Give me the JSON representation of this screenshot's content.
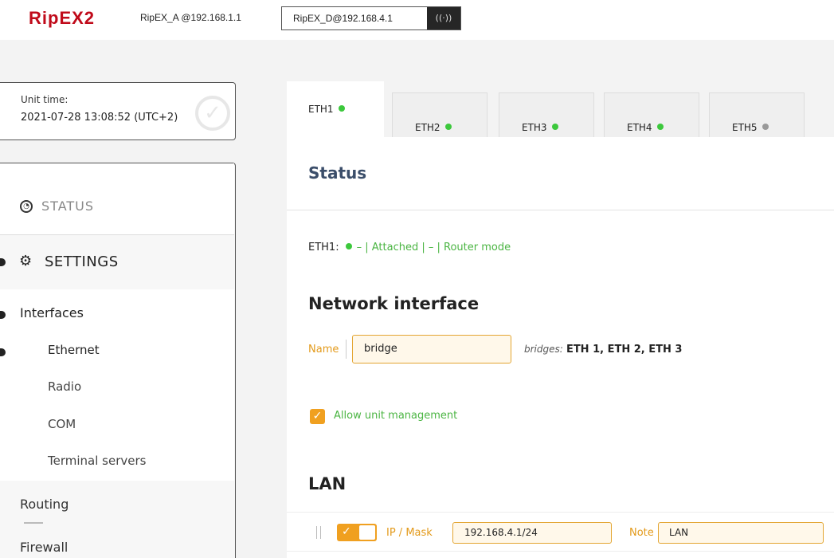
{
  "header": {
    "logo": "RipEX2",
    "unit_a": "RipEX_A @192.168.1.1",
    "unit_d": "RipEX_D@192.168.4.1",
    "signal_icon": "signal-icon"
  },
  "unit_time": {
    "label": "Unit time:",
    "value": "2021-07-28 13:08:52 (UTC+2)"
  },
  "sidebar": {
    "status": "STATUS",
    "settings": "SETTINGS",
    "interfaces": "Interfaces",
    "submenu": [
      "Ethernet",
      "Radio",
      "COM",
      "Terminal servers"
    ],
    "routing": "Routing",
    "firewall": "Firewall"
  },
  "tabs": [
    {
      "label": "ETH1",
      "status": "green"
    },
    {
      "label": "ETH2",
      "status": "green"
    },
    {
      "label": "ETH3",
      "status": "green"
    },
    {
      "label": "ETH4",
      "status": "green"
    },
    {
      "label": "ETH5",
      "status": "gray"
    }
  ],
  "main": {
    "status_title": "Status",
    "eth_prefix": "ETH1:",
    "eth_status": "– | Attached | – | Router mode",
    "network_interface_title": "Network interface",
    "name_label": "Name",
    "name_value": "bridge",
    "bridges_label": "bridges:",
    "bridges_value": "ETH 1, ETH 2, ETH 3",
    "allow_label": "Allow unit management",
    "lan_title": "LAN",
    "ipmask_label": "IP / Mask",
    "ipmask_value": "192.168.4.1/24",
    "note_label": "Note",
    "note_value": "LAN"
  },
  "colors": {
    "brand": "#c00a1a",
    "accent": "#f0a020",
    "ok": "#3cc83c",
    "title": "#3b4e6a"
  }
}
